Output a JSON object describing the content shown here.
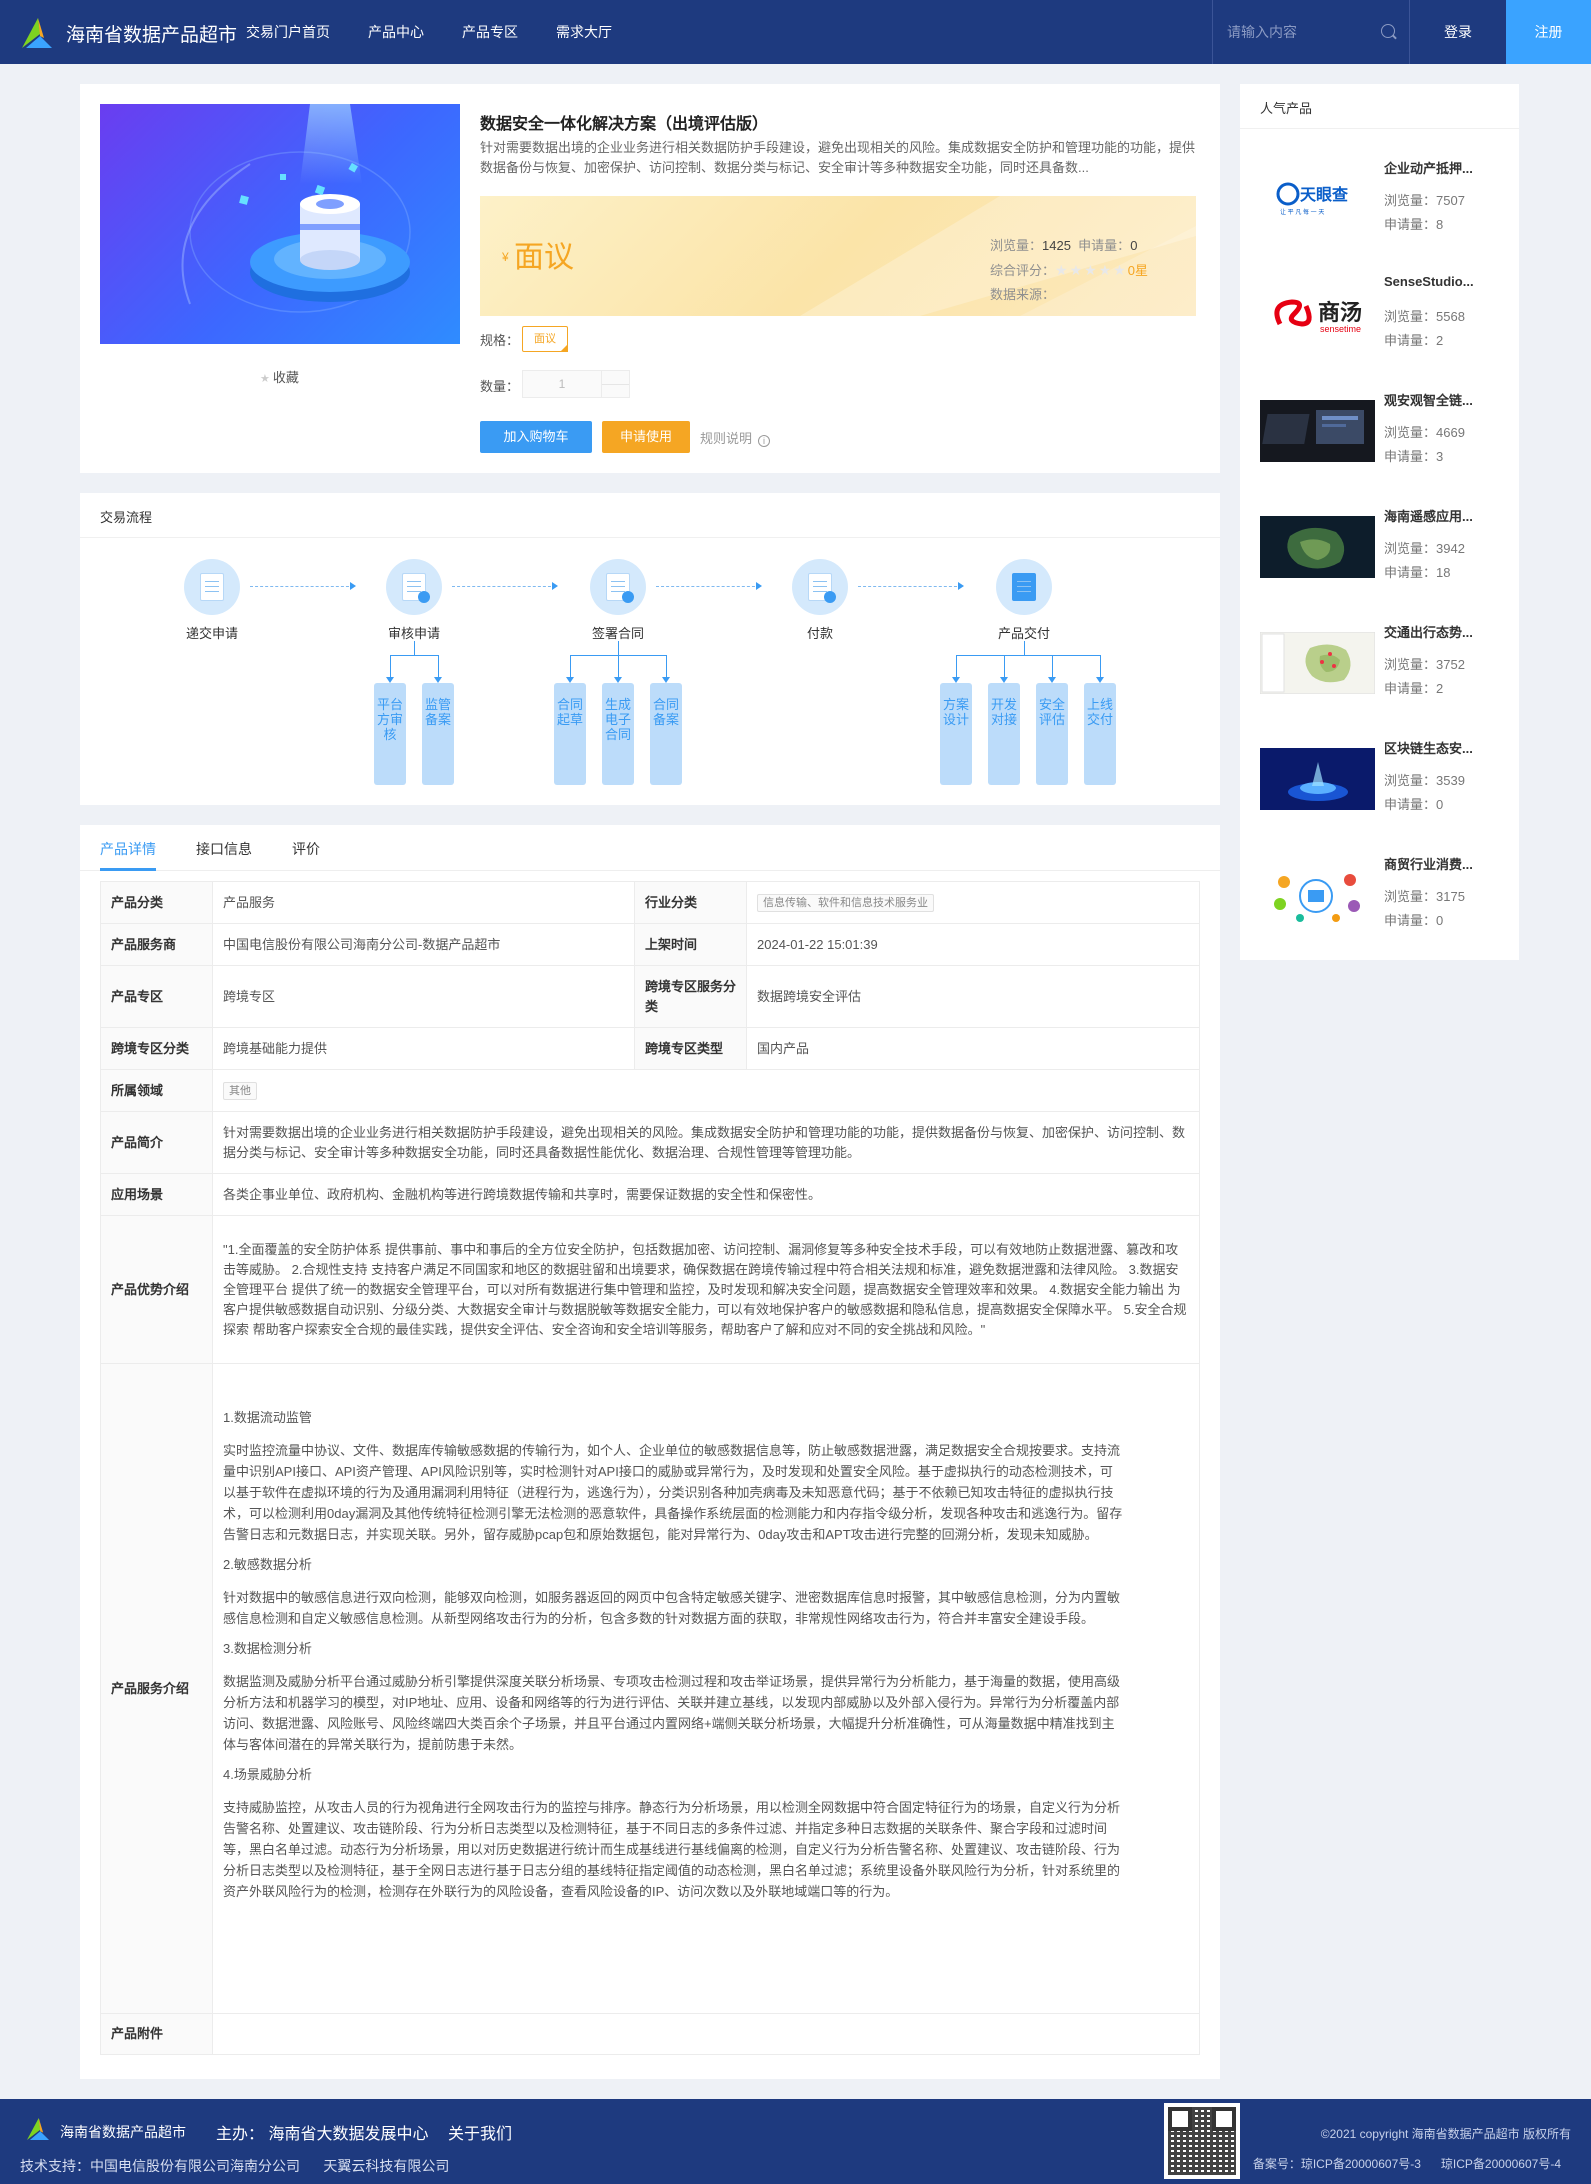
{
  "header": {
    "site_title": "海南省数据产品超市",
    "nav": [
      "交易门户首页",
      "产品中心",
      "产品专区",
      "需求大厅"
    ],
    "search_placeholder": "请输入内容",
    "login": "登录",
    "register": "注册"
  },
  "product": {
    "title": "数据安全一体化解决方案（出境评估版）",
    "description": "针对需要数据出境的企业业务进行相关数据防护手段建设，避免出现相关的风险。集成数据安全防护和管理功能的功能，提供数据备份与恢复、加密保护、访问控制、数据分类与标记、安全审计等多种数据安全功能，同时还具备数...",
    "favorite": "收藏",
    "price_symbol": "¥",
    "price": "面议",
    "views_label": "浏览量：",
    "views": "1425",
    "applies_label": "申请量：",
    "applies": "0",
    "rating_label": "综合评分：",
    "rating_stars": "★★★★★",
    "rating": "0星",
    "source_label": "数据来源：",
    "spec_label": "规格：",
    "spec_value": "面议",
    "qty_label": "数量：",
    "qty_value": "1",
    "add_cart": "加入购物车",
    "apply": "申请使用",
    "rules": "规则说明",
    "info_icon": "i"
  },
  "popular": {
    "title": "人气产品",
    "views_label": "浏览量：",
    "applies_label": "申请量：",
    "items": [
      {
        "name": "企业动产抵押...",
        "views": "7507",
        "applies": "8"
      },
      {
        "name": "SenseStudio...",
        "views": "5568",
        "applies": "2"
      },
      {
        "name": "观安观智全链...",
        "views": "4669",
        "applies": "3"
      },
      {
        "name": "海南遥感应用...",
        "views": "3942",
        "applies": "18"
      },
      {
        "name": "交通出行态势...",
        "views": "3752",
        "applies": "2"
      },
      {
        "name": "区块链生态安...",
        "views": "3539",
        "applies": "0"
      },
      {
        "name": "商贸行业消费...",
        "views": "3175",
        "applies": "0"
      }
    ],
    "logo_tianyancha": "天眼查",
    "logo_tianyancha_sub": "TianYancha.com",
    "logo_tianyancha_slogan": "让 平 凡 每 一 天",
    "logo_sensetime": "商汤",
    "logo_sensetime_sub": "sensetime"
  },
  "process": {
    "title": "交易流程",
    "steps": [
      "递交申请",
      "审核申请",
      "签署合同",
      "付款",
      "产品交付"
    ],
    "review_subs": [
      "平台方审核",
      "监管备案"
    ],
    "contract_subs": [
      "合同起草",
      "生成电子合同",
      "合同备案"
    ],
    "delivery_subs": [
      "方案设计",
      "开发对接",
      "安全评估",
      "上线交付"
    ]
  },
  "tabs": [
    "产品详情",
    "接口信息",
    "评价"
  ],
  "details": {
    "category_label": "产品分类",
    "category": "产品服务",
    "industry_label": "行业分类",
    "industry": "信息传输、软件和信息技术服务业",
    "provider_label": "产品服务商",
    "provider": "中国电信股份有限公司海南分公司-数据产品超市",
    "listed_label": "上架时间",
    "listed": "2024-01-22 15:01:39",
    "zone_label": "产品专区",
    "zone": "跨境专区",
    "cross_service_label": "跨境专区服务分类",
    "cross_service": "数据跨境安全评估",
    "cross_cat_label": "跨境专区分类",
    "cross_cat": "跨境基础能力提供",
    "cross_type_label": "跨境专区类型",
    "cross_type": "国内产品",
    "domain_label": "所属领域",
    "domain": "其他",
    "intro_label": "产品简介",
    "intro": "针对需要数据出境的企业业务进行相关数据防护手段建设，避免出现相关的风险。集成数据安全防护和管理功能的功能，提供数据备份与恢复、加密保护、访问控制、数据分类与标记、安全审计等多种数据安全功能，同时还具备数据性能优化、数据治理、合规性管理等管理功能。",
    "scene_label": "应用场景",
    "scene": "各类企事业单位、政府机构、金融机构等进行跨境数据传输和共享时，需要保证数据的安全性和保密性。",
    "advantage_label": "产品优势介绍",
    "advantage": "\"1.全面覆盖的安全防护体系 提供事前、事中和事后的全方位安全防护，包括数据加密、访问控制、漏洞修复等多种安全技术手段，可以有效地防止数据泄露、篡改和攻击等威胁。 2.合规性支持 支持客户满足不同国家和地区的数据驻留和出境要求，确保数据在跨境传输过程中符合相关法规和标准，避免数据泄露和法律风险。 3.数据安全管理平台 提供了统一的数据安全管理平台，可以对所有数据进行集中管理和监控，及时发现和解决安全问题，提高数据安全管理效率和效果。 4.数据安全能力输出 为客户提供敏感数据自动识别、分级分类、大数据安全审计与数据脱敏等数据安全能力，可以有效地保护客户的敏感数据和隐私信息，提高数据安全保障水平。 5.安全合规探索 帮助客户探索安全合规的最佳实践，提供安全评估、安全咨询和安全培训等服务，帮助客户了解和应对不同的安全挑战和风险。\"",
    "service_label": "产品服务介绍",
    "service": [
      {
        "h": "1.数据流动监管",
        "p": "实时监控流量中协议、文件、数据库传输敏感数据的传输行为，如个人、企业单位的敏感数据信息等，防止敏感数据泄露，满足数据安全合规按要求。支持流量中识别API接口、API资产管理、API风险识别等，实时检测针对API接口的威胁或异常行为，及时发现和处置安全风险。基于虚拟执行的动态检测技术，可以基于软件在虚拟环境的行为及通用漏洞利用特征（进程行为，逃逸行为），分类识别各种加壳病毒及未知恶意代码；基于不依赖已知攻击特征的虚拟执行技术，可以检测利用0day漏洞及其他传统特征检测引擎无法检测的恶意软件，具备操作系统层面的检测能力和内存指令级分析，发现各种攻击和逃逸行为。留存告警日志和元数据日志，并实现关联。另外，留存威胁pcap包和原始数据包，能对异常行为、0day攻击和APT攻击进行完整的回溯分析，发现未知威胁。"
      },
      {
        "h": "2.敏感数据分析",
        "p": "针对数据中的敏感信息进行双向检测，能够双向检测，如服务器返回的网页中包含特定敏感关键字、泄密数据库信息时报警，其中敏感信息检测，分为内置敏感信息检测和自定义敏感信息检测。从新型网络攻击行为的分析，包含多数的针对数据方面的获取，非常规性网络攻击行为，符合并丰富安全建设手段。"
      },
      {
        "h": "3.数据检测分析",
        "p": "数据监测及威胁分析平台通过威胁分析引擎提供深度关联分析场景、专项攻击检测过程和攻击举证场景，提供异常行为分析能力，基于海量的数据，使用高级分析方法和机器学习的模型，对IP地址、应用、设备和网络等的行为进行评估、关联并建立基线，以发现内部威胁以及外部入侵行为。异常行为分析覆盖内部访问、数据泄露、风险账号、风险终端四大类百余个子场景，并且平台通过内置网络+端侧关联分析场景，大幅提升分析准确性，可从海量数据中精准找到主体与客体间潜在的异常关联行为，提前防患于未然。"
      },
      {
        "h": "4.场景威胁分析",
        "p": "支持威胁监控，从攻击人员的行为视角进行全网攻击行为的监控与排序。静态行为分析场景，用以检测全网数据中符合固定特征行为的场景，自定义行为分析告警名称、处置建议、攻击链阶段、行为分析日志类型以及检测特征，基于不同日志的多条件过滤、并指定多种日志数据的关联条件、聚合字段和过滤时间等，黑白名单过滤。动态行为分析场景，用以对历史数据进行统计而生成基线进行基线偏离的检测，自定义行为分析告警名称、处置建议、攻击链阶段、行为分析日志类型以及检测特征，基于全网日志进行基于日志分组的基线特征指定阈值的动态检测，黑白名单过滤；系统里设备外联风险行为分析，针对系统里的资产外联风险行为的检测，检测存在外联行为的风险设备，查看风险设备的IP、访问次数以及外联地域端口等的行为。"
      }
    ],
    "attachment_label": "产品附件"
  },
  "footer": {
    "title": "海南省数据产品超市",
    "host": "主办：  海南省大数据发展中心",
    "about": "关于我们",
    "tech": "技术支持：中国电信股份有限公司海南分公司      天翼云科技有限公司",
    "copyright": "©2021 copyright 海南省数据产品超市 版权所有",
    "icp1": "备案号：琼ICP备20000607号-3",
    "icp2": "琼ICP备20000607号-4"
  },
  "colors": {
    "header": "#1e3a7f",
    "accent": "#3a9bf3",
    "orange": "#f5a623"
  }
}
